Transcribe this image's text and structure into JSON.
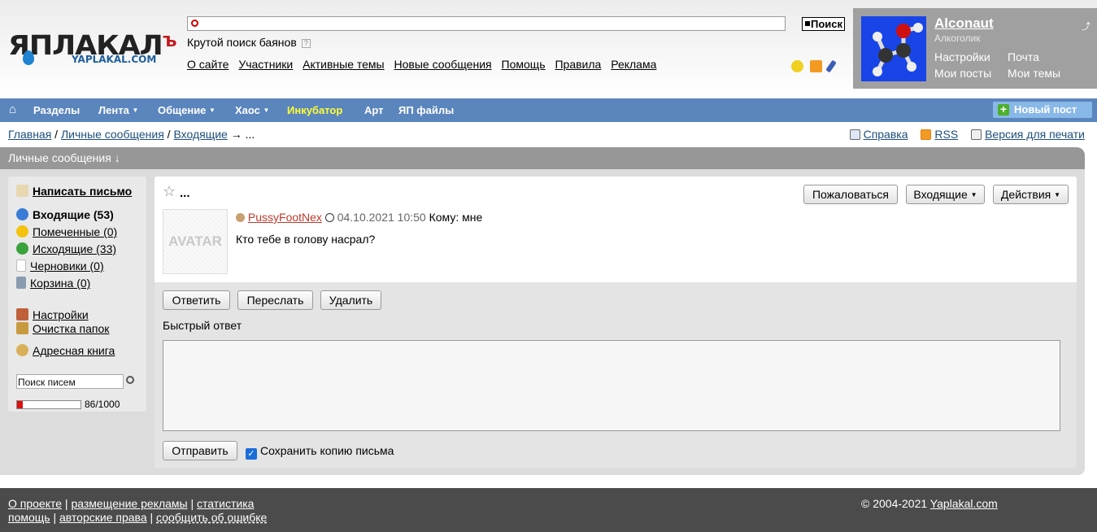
{
  "logo": {
    "main": "ЯПЛАКАЛ",
    "suffix": "Ъ",
    "sub": "YAPLAKAL.COM"
  },
  "search": {
    "placeholder": "",
    "button": "Поиск",
    "hint": "Крутой поиск баянов",
    "hint_icon": "?"
  },
  "topnav": [
    "О сайте",
    "Участники",
    "Активные темы",
    "Новые сообщения",
    "Помощь",
    "Правила",
    "Реклама"
  ],
  "topicons": [
    "star-plus-icon",
    "rss-icon",
    "pen-icon"
  ],
  "user": {
    "name": "Alconaut",
    "rank": "Алкоголик",
    "links": [
      "Настройки",
      "Почта",
      "Мои посты",
      "Мои темы"
    ]
  },
  "menubar": {
    "home_icon": "⌂",
    "items": [
      {
        "label": "Разделы",
        "dropdown": false
      },
      {
        "label": "Лента",
        "dropdown": true
      },
      {
        "label": "Общение",
        "dropdown": true
      },
      {
        "label": "Хаос",
        "dropdown": true
      },
      {
        "label": "Инкубатор",
        "dropdown": false,
        "highlight": true
      },
      {
        "label": "Арт",
        "dropdown": false
      },
      {
        "label": "ЯП файлы",
        "dropdown": false
      }
    ],
    "new_post": "Новый пост"
  },
  "breadcrumb": {
    "items": [
      "Главная",
      "Личные сообщения",
      "Входящие"
    ],
    "current": "..."
  },
  "tools": {
    "help": "Справка",
    "rss": "RSS",
    "print": "Версия для печати"
  },
  "section_title": "Личные сообщения ↓",
  "sidebar": {
    "compose": "Написать письмо",
    "folders": [
      {
        "label": "Входящие (53)",
        "active": true,
        "icon": "inbox-icon",
        "color": "#3a7bd5"
      },
      {
        "label": "Помеченные (0)",
        "active": false,
        "icon": "star-icon",
        "color": "#f4c20d"
      },
      {
        "label": "Исходящие (33)",
        "active": false,
        "icon": "outbox-icon",
        "color": "#3aa23a"
      },
      {
        "label": "Черновики (0)",
        "active": false,
        "icon": "draft-icon",
        "color": "#cccccc"
      },
      {
        "label": "Корзина (0)",
        "active": false,
        "icon": "trash-icon",
        "color": "#8a9bb0"
      }
    ],
    "settings": "Настройки",
    "clean": "Очистка папок",
    "addressbook": "Адресная книга",
    "search_placeholder": "Поиск писем",
    "quota_text": "86/1000",
    "quota_fraction": 0.086
  },
  "message": {
    "subject": "...",
    "buttons": {
      "report": "Пожаловаться",
      "folder": "Входящие",
      "actions": "Действия"
    },
    "avatar": "AVATAR",
    "author": "PussyFootNex",
    "date": "04.10.2021 10:50",
    "to": "Кому: мне",
    "text": "Кто тебе в голову насрал?",
    "reply": "Ответить",
    "forward": "Переслать",
    "delete": "Удалить",
    "quick_reply_label": "Быстрый ответ",
    "send": "Отправить",
    "save_copy": "Сохранить копию письма",
    "save_copy_checked": true
  },
  "footer": {
    "line1": [
      "О проекте",
      "размещение рекламы",
      "статистика"
    ],
    "line2": [
      "помощь",
      "авторские права",
      "сообщить об ошибке"
    ],
    "copyright": "© 2004-2021",
    "site": "Yaplakal.com"
  }
}
